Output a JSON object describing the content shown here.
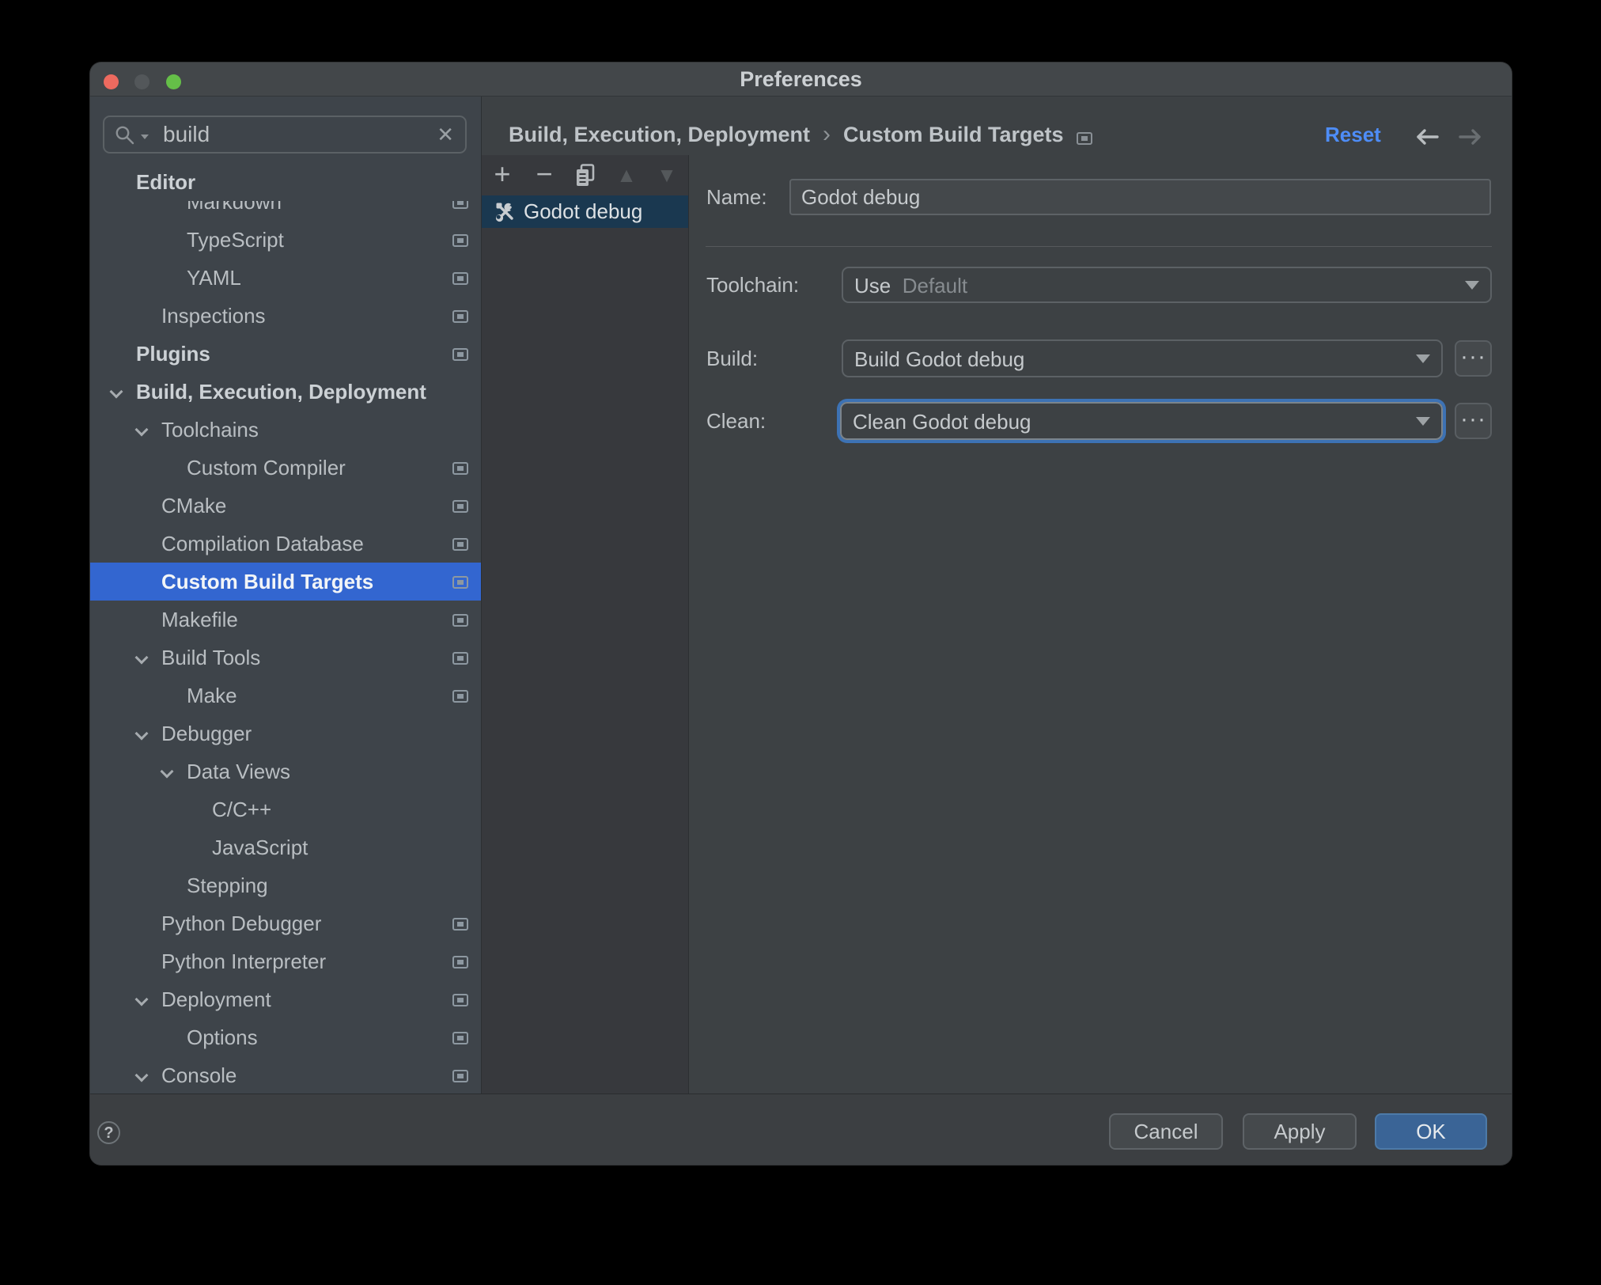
{
  "window": {
    "title": "Preferences"
  },
  "sidebar": {
    "search": {
      "value": "build"
    },
    "sticky_section": "Editor",
    "tree": [
      {
        "label": "Markdown",
        "level": 2,
        "icon": true
      },
      {
        "label": "TypeScript",
        "level": 2,
        "icon": true
      },
      {
        "label": "YAML",
        "level": 2,
        "icon": true
      },
      {
        "label": "Inspections",
        "level": 1,
        "icon": true
      },
      {
        "label": "Plugins",
        "level": 0,
        "bold": true,
        "icon": true
      },
      {
        "label": "Build, Execution, Deployment",
        "level": 0,
        "bold": true,
        "chevron": true
      },
      {
        "label": "Toolchains",
        "level": 1,
        "chevron": true
      },
      {
        "label": "Custom Compiler",
        "level": 2,
        "icon": true
      },
      {
        "label": "CMake",
        "level": 1,
        "icon": true
      },
      {
        "label": "Compilation Database",
        "level": 1,
        "icon": true
      },
      {
        "label": "Custom Build Targets",
        "level": 1,
        "icon": true,
        "selected": true
      },
      {
        "label": "Makefile",
        "level": 1,
        "icon": true
      },
      {
        "label": "Build Tools",
        "level": 1,
        "chevron": true,
        "icon": true
      },
      {
        "label": "Make",
        "level": 2,
        "icon": true
      },
      {
        "label": "Debugger",
        "level": 1,
        "chevron": true
      },
      {
        "label": "Data Views",
        "level": 2,
        "chevron": true
      },
      {
        "label": "C/C++",
        "level": 3
      },
      {
        "label": "JavaScript",
        "level": 3
      },
      {
        "label": "Stepping",
        "level": 2
      },
      {
        "label": "Python Debugger",
        "level": 1,
        "icon": true
      },
      {
        "label": "Python Interpreter",
        "level": 1,
        "icon": true
      },
      {
        "label": "Deployment",
        "level": 1,
        "chevron": true,
        "icon": true
      },
      {
        "label": "Options",
        "level": 2,
        "icon": true
      },
      {
        "label": "Console",
        "level": 1,
        "chevron": true,
        "icon": true
      }
    ]
  },
  "list": {
    "items": [
      {
        "label": "Godot debug",
        "selected": true
      }
    ]
  },
  "header": {
    "breadcrumb_1": "Build, Execution, Deployment",
    "breadcrumb_sep": "›",
    "breadcrumb_2": "Custom Build Targets",
    "reset": "Reset"
  },
  "form": {
    "name_label": "Name:",
    "name_value": "Godot debug",
    "toolchain_label": "Toolchain:",
    "toolchain_prefix": "Use",
    "toolchain_value": "Default",
    "build_label": "Build:",
    "build_value": "Build Godot debug",
    "clean_label": "Clean:",
    "clean_value": "Clean Godot debug",
    "more": "···"
  },
  "footer": {
    "help": "?",
    "cancel": "Cancel",
    "apply": "Apply",
    "ok": "OK"
  },
  "colors": {
    "selection_blue": "#3366d0",
    "list_selection": "#1a3850",
    "reset_link": "#4e8df8",
    "ok_button": "#3a6496"
  }
}
